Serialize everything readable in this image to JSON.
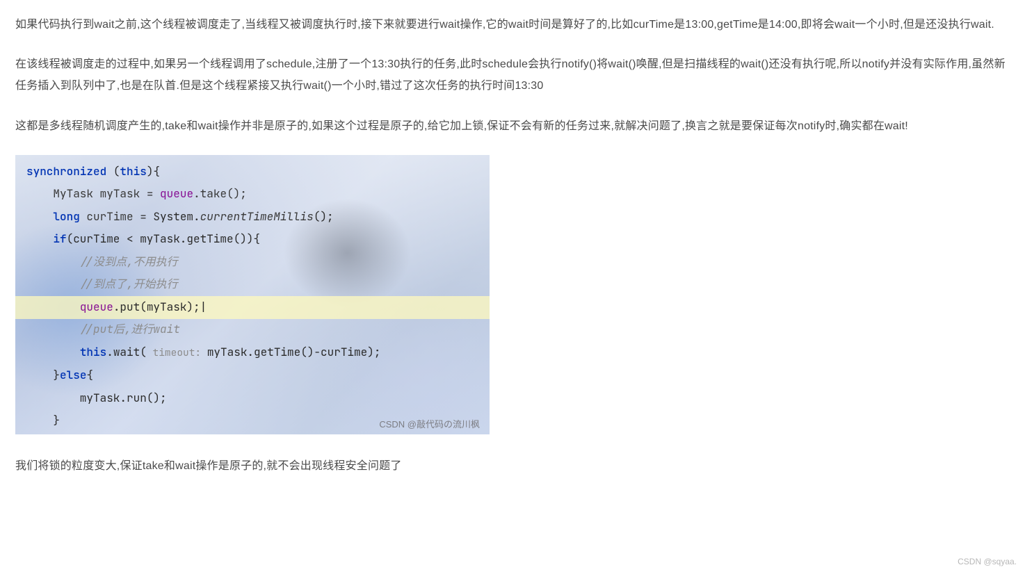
{
  "paragraphs": {
    "p1": "如果代码执行到wait之前,这个线程被调度走了,当线程又被调度执行时,接下来就要进行wait操作,它的wait时间是算好了的,比如curTime是13:00,getTime是14:00,即将会wait一个小时,但是还没执行wait.",
    "p2": "在该线程被调度走的过程中,如果另一个线程调用了schedule,注册了一个13:30执行的任务,此时schedule会执行notify()将wait()唤醒,但是扫描线程的wait()还没有执行呢,所以notify并没有实际作用,虽然新任务插入到队列中了,也是在队首.但是这个线程紧接又执行wait()一个小时,错过了这次任务的执行时间13:30",
    "p3": "这都是多线程随机调度产生的,take和wait操作并非是原子的,如果这个过程是原子的,给它加上锁,保证不会有新的任务过来,就解决问题了,换言之就是要保证每次notify时,确实都在wait!",
    "p4": "我们将锁的粒度变大,保证take和wait操作是原子的,就不会出现线程安全问题了"
  },
  "code": {
    "l1": {
      "kw_sync": "synchronized",
      "punc1": " (",
      "kw_this": "this",
      "punc2": "){"
    },
    "l2": {
      "indent": "    ",
      "type": "MyTask",
      "sp1": " ",
      "var": "myTask",
      "sp2": " = ",
      "field": "queue",
      "rest": ".take();"
    },
    "l3": {
      "indent": "    ",
      "kw_long": "long",
      "sp1": " ",
      "var": "curTime",
      "sp2": " = System.",
      "method": "currentTimeMillis",
      "rest": "();"
    },
    "l4": {
      "indent": "    ",
      "kw_if": "if",
      "rest": "(curTime < myTask.getTime()){"
    },
    "l5": {
      "indent": "        ",
      "comment": "//没到点,不用执行"
    },
    "l6": {
      "indent": "        ",
      "comment": "//到点了,开始执行"
    },
    "l7": {
      "indent": "        ",
      "field": "queue",
      "rest": ".put(myTask);",
      "caret": "|"
    },
    "l8": {
      "indent": "        ",
      "comment": "//put后,进行wait"
    },
    "l9": {
      "indent": "        ",
      "kw_this": "this",
      "rest1": ".wait(",
      "hint": " timeout: ",
      "rest2": "myTask.getTime()-curTime);"
    },
    "l10": {
      "indent": "    }",
      "kw_else": "else",
      "rest": "{"
    },
    "l11": {
      "indent": "        myTask.run();"
    },
    "l12": {
      "indent": "    }"
    },
    "l13": {
      "indent": "}"
    }
  },
  "watermarks": {
    "inset": "CSDN @敲代码の流川枫",
    "page": "CSDN @sqyaa."
  }
}
